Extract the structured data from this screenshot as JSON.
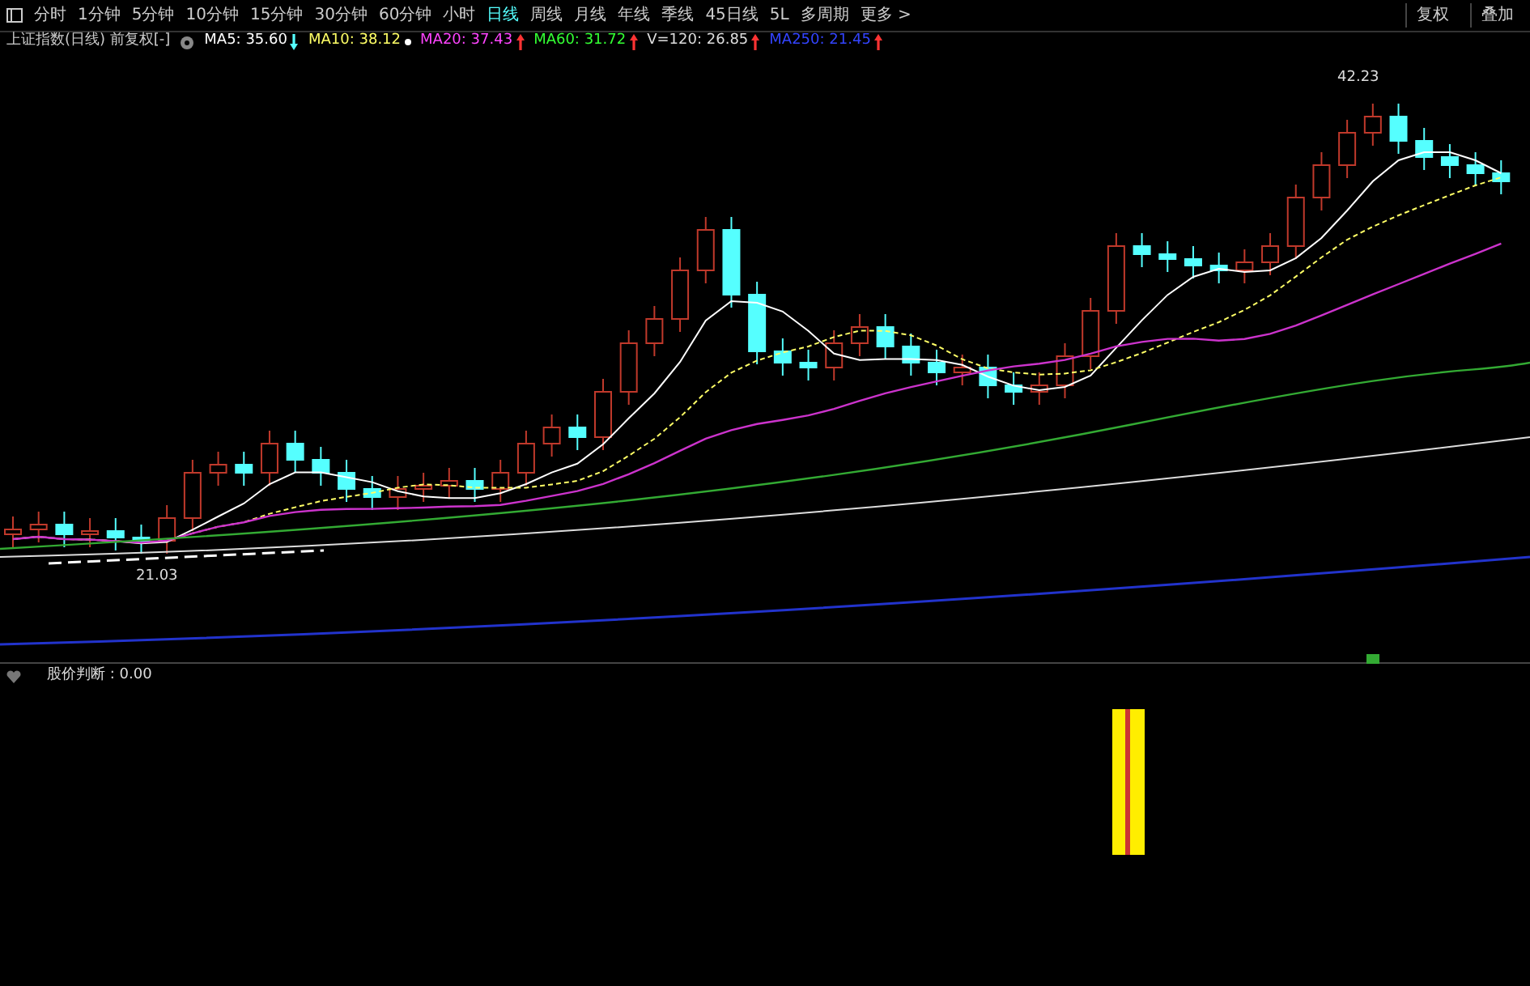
{
  "toolbar": {
    "tabs": [
      {
        "label": "分时",
        "selected": false
      },
      {
        "label": "1分钟",
        "selected": false
      },
      {
        "label": "5分钟",
        "selected": false
      },
      {
        "label": "10分钟",
        "selected": false
      },
      {
        "label": "15分钟",
        "selected": false
      },
      {
        "label": "30分钟",
        "selected": false
      },
      {
        "label": "60分钟",
        "selected": false
      },
      {
        "label": "小时",
        "selected": false
      },
      {
        "label": "日线",
        "selected": true
      },
      {
        "label": "周线",
        "selected": false
      },
      {
        "label": "月线",
        "selected": false
      },
      {
        "label": "年线",
        "selected": false
      },
      {
        "label": "季线",
        "selected": false
      },
      {
        "label": "45日线",
        "selected": false
      },
      {
        "label": "5L",
        "selected": false
      },
      {
        "label": "多周期",
        "selected": false
      },
      {
        "label": "更多 >",
        "selected": false
      }
    ],
    "right_buttons": [
      "复权",
      "叠加"
    ]
  },
  "legend": {
    "title": "上证指数(日线) 前复权[-]",
    "items": [
      {
        "label": "MA5: 35.60",
        "color": "#ffffff",
        "kind": "down"
      },
      {
        "label": "MA10: 38.12",
        "color": "#ffff66",
        "kind": "flat"
      },
      {
        "label": "MA20: 37.43",
        "color": "#ff44ff",
        "kind": "up"
      },
      {
        "label": "MA60: 31.72",
        "color": "#33ff33",
        "kind": "up"
      },
      {
        "label": "V=120: 26.85",
        "color": "#dddddd",
        "kind": "up"
      },
      {
        "label": "MA250: 21.45",
        "color": "#3344ff",
        "kind": "up"
      }
    ]
  },
  "main_chart": {
    "high_label": "42.23",
    "low_label": "21.03"
  },
  "indicator": {
    "label": "股价判断 : 0.00"
  }
}
